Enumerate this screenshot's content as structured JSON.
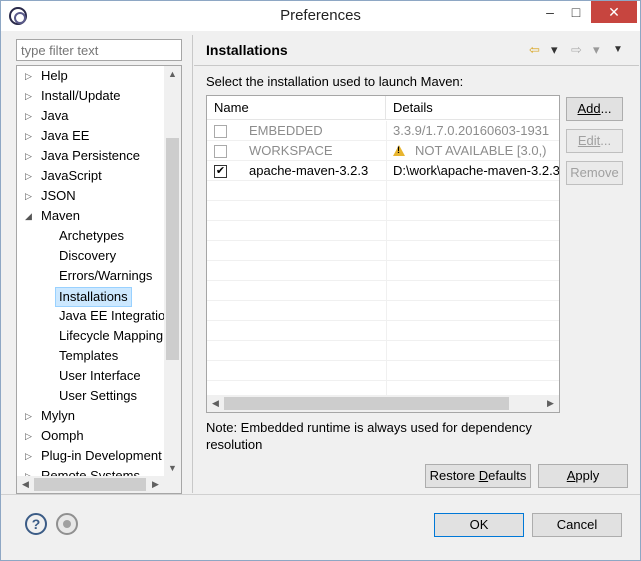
{
  "window": {
    "title": "Preferences"
  },
  "titlebar": {
    "minimize": "–",
    "maximize": "□",
    "close": "✕"
  },
  "filter": {
    "placeholder": "type filter text"
  },
  "tree": {
    "items": [
      {
        "label": "Help",
        "arrow": "▷",
        "level": 0
      },
      {
        "label": "Install/Update",
        "arrow": "▷",
        "level": 0
      },
      {
        "label": "Java",
        "arrow": "▷",
        "level": 0
      },
      {
        "label": "Java EE",
        "arrow": "▷",
        "level": 0
      },
      {
        "label": "Java Persistence",
        "arrow": "▷",
        "level": 0
      },
      {
        "label": "JavaScript",
        "arrow": "▷",
        "level": 0
      },
      {
        "label": "JSON",
        "arrow": "▷",
        "level": 0
      },
      {
        "label": "Maven",
        "arrow": "◢",
        "level": 0
      },
      {
        "label": "Archetypes",
        "arrow": "",
        "level": 1
      },
      {
        "label": "Discovery",
        "arrow": "",
        "level": 1
      },
      {
        "label": "Errors/Warnings",
        "arrow": "",
        "level": 1
      },
      {
        "label": "Installations",
        "arrow": "",
        "level": 1
      },
      {
        "label": "Java EE Integration",
        "arrow": "",
        "level": 1
      },
      {
        "label": "Lifecycle Mapping",
        "arrow": "",
        "level": 1
      },
      {
        "label": "Templates",
        "arrow": "",
        "level": 1
      },
      {
        "label": "User Interface",
        "arrow": "",
        "level": 1
      },
      {
        "label": "User Settings",
        "arrow": "",
        "level": 1
      },
      {
        "label": "Mylyn",
        "arrow": "▷",
        "level": 0
      },
      {
        "label": "Oomph",
        "arrow": "▷",
        "level": 0
      },
      {
        "label": "Plug-in Development",
        "arrow": "▷",
        "level": 0
      },
      {
        "label": "Remote Systems",
        "arrow": "▷",
        "level": 0
      }
    ],
    "selected": "Installations"
  },
  "page": {
    "title": "Installations",
    "prompt": "Select the installation used to launch Maven:",
    "nav": {
      "back": "⇦",
      "back_menu": "▾",
      "forward": "⇨",
      "forward_menu": "▾",
      "view_menu": "▼"
    }
  },
  "table": {
    "columns": [
      "Name",
      "Details"
    ],
    "rows": [
      {
        "name": "EMBEDDED",
        "details": "3.3.9/1.7.0.20160603-1931",
        "checked": false,
        "enabled": false,
        "warning": false
      },
      {
        "name": "WORKSPACE",
        "details": "NOT AVAILABLE [3.0,)",
        "checked": false,
        "enabled": false,
        "warning": true
      },
      {
        "name": "apache-maven-3.2.3",
        "details": "D:\\work\\apache-maven-3.2.3",
        "checked": true,
        "enabled": true,
        "warning": false
      }
    ]
  },
  "buttons": {
    "add_pre": "Add",
    "add_post": "...",
    "edit_pre": "Edit",
    "edit_post": "...",
    "remove": "Remove",
    "restore_pre": "Restore ",
    "restore_ul": "D",
    "restore_post": "efaults",
    "apply_ul": "A",
    "apply_post": "pply",
    "ok": "OK",
    "cancel": "Cancel"
  },
  "note": "Note: Embedded runtime is always used for dependency resolution",
  "footer": {
    "help_icon": "?"
  }
}
